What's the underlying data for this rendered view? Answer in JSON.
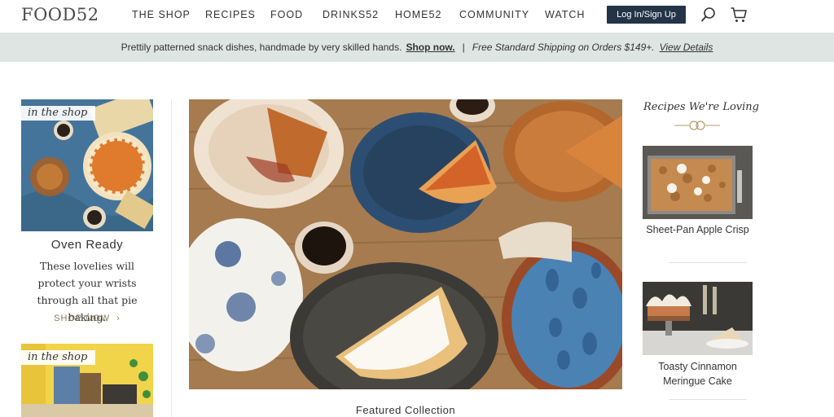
{
  "header": {
    "logo": "FOOD52",
    "nav": [
      "THE SHOP",
      "RECIPES",
      "FOOD",
      "DRINKS52",
      "HOME52",
      "COMMUNITY",
      "WATCH"
    ],
    "login_label": "Log In/Sign Up",
    "search_icon": "search-icon",
    "cart_icon": "cart-icon",
    "login_color": "#243447"
  },
  "promo": {
    "text": "Prettily patterned snack dishes, handmade by very skilled hands.",
    "link": "Shop now.",
    "separator": "|",
    "shipping": "Free Standard Shipping on Orders $149+.",
    "details_link": "View Details",
    "background": "#dfe5e2"
  },
  "left": {
    "card1": {
      "tag": "in the shop",
      "title": "Oven Ready",
      "description": "These lovelies will protect your wrists through all that pie baking.",
      "cta": "SHOP NOW"
    },
    "card2": {
      "tag": "in the shop"
    }
  },
  "hero": {
    "caption": "Featured Collection"
  },
  "right": {
    "heading": "Recipes We're Loving",
    "recipes": [
      {
        "title": "Sheet-Pan Apple Crisp"
      },
      {
        "title": "Toasty Cinnamon Meringue Cake"
      }
    ]
  }
}
